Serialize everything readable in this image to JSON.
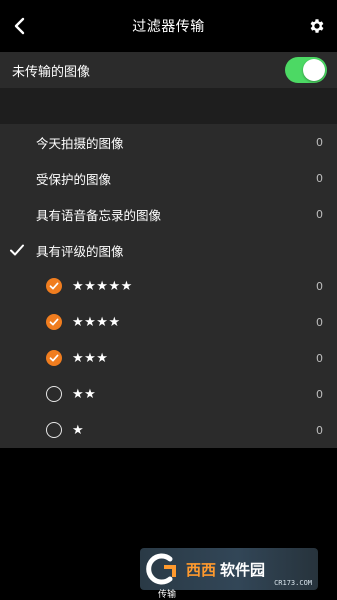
{
  "header": {
    "title": "过滤器传输",
    "back_icon": "chevron-left-icon",
    "settings_icon": "gear-icon"
  },
  "untransferred_toggle": {
    "label": "未传输的图像",
    "state": "on",
    "color": "#4cd964"
  },
  "filters": [
    {
      "label": "今天拍摄的图像",
      "count": "0",
      "checked": false
    },
    {
      "label": "受保护的图像",
      "count": "0",
      "checked": false
    },
    {
      "label": "具有语音备忘录的图像",
      "count": "0",
      "checked": false
    },
    {
      "label": "具有评级的图像",
      "count": "",
      "checked": true
    }
  ],
  "ratings": [
    {
      "stars": "★★★★★",
      "count": "0",
      "selected": true
    },
    {
      "stars": "★★★★",
      "count": "0",
      "selected": true
    },
    {
      "stars": "★★★",
      "count": "0",
      "selected": true
    },
    {
      "stars": "★★",
      "count": "0",
      "selected": false
    },
    {
      "stars": "★",
      "count": "0",
      "selected": false
    }
  ],
  "accent_color": "#f07d1f",
  "tabbar": {
    "label": "传输"
  },
  "watermark": {
    "logo_text": "西西",
    "brand_text": "软件园",
    "url_text": "CR173.COM"
  }
}
